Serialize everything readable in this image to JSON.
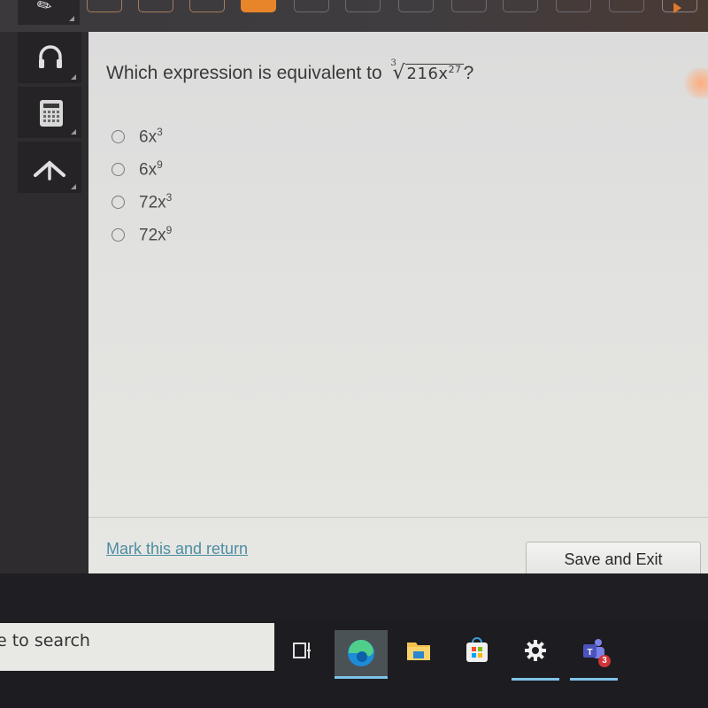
{
  "topbar": {
    "question_nav": [
      {
        "label": "",
        "state": "answered"
      },
      {
        "label": "",
        "state": "answered"
      },
      {
        "label": "",
        "state": "answered"
      },
      {
        "label": "",
        "state": "current"
      },
      {
        "label": "",
        "state": "unanswered"
      },
      {
        "label": "",
        "state": "unanswered"
      },
      {
        "label": "",
        "state": "unanswered"
      },
      {
        "label": "",
        "state": "unanswered"
      },
      {
        "label": "",
        "state": "unanswered"
      },
      {
        "label": "",
        "state": "unanswered"
      },
      {
        "label": "",
        "state": "unanswered"
      }
    ],
    "accent_color": "#e8852a"
  },
  "sidebar": {
    "tools": [
      {
        "name": "pencil-icon"
      },
      {
        "name": "headphones-icon"
      },
      {
        "name": "calculator-icon"
      },
      {
        "name": "reference-arrow-icon"
      }
    ]
  },
  "question": {
    "prompt": "Which expression is equivalent to",
    "radical_index": "3",
    "radicand_base": "216x",
    "radicand_exponent": "27",
    "end_mark": "?",
    "options": [
      {
        "coef": "6x",
        "exp": "3",
        "selected": false
      },
      {
        "coef": "6x",
        "exp": "9",
        "selected": false
      },
      {
        "coef": "72x",
        "exp": "3",
        "selected": false
      },
      {
        "coef": "72x",
        "exp": "9",
        "selected": false
      }
    ]
  },
  "footer": {
    "mark_link": "Mark this and return",
    "save_exit": "Save and Exit",
    "link_color": "#4f8da3"
  },
  "taskbar": {
    "search_placeholder": "e to search",
    "apps": [
      {
        "name": "task-view-icon",
        "active": false
      },
      {
        "name": "edge-browser-icon",
        "active": true
      },
      {
        "name": "file-explorer-icon",
        "active": false
      },
      {
        "name": "microsoft-store-icon",
        "active": false
      },
      {
        "name": "settings-gear-icon",
        "active": false
      },
      {
        "name": "teams-icon",
        "active": false,
        "badge": "3"
      }
    ]
  }
}
